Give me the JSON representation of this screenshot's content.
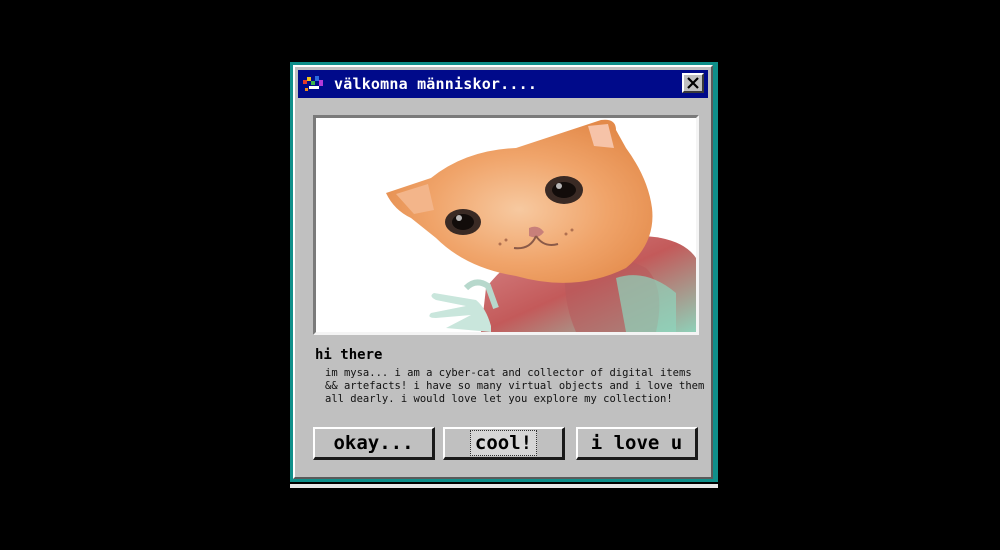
{
  "window": {
    "title": "välkomna människor....",
    "icon": "cat-app-icon",
    "close_label": "close"
  },
  "image": {
    "description_icon": "cat-photo"
  },
  "content": {
    "heading": "hi there",
    "body": "im mysa... i am a cyber-cat and collector of digital items && artefacts! i have so many virtual objects and i love them all dearly. i would love let you explore my collection!"
  },
  "buttons": [
    {
      "label": "okay..."
    },
    {
      "label": "cool!"
    },
    {
      "label": "i love u"
    }
  ],
  "colors": {
    "background": "#000000",
    "frame": "#0f8f8a",
    "titlebar": "#000a8a",
    "window": "#c0c0c0"
  }
}
